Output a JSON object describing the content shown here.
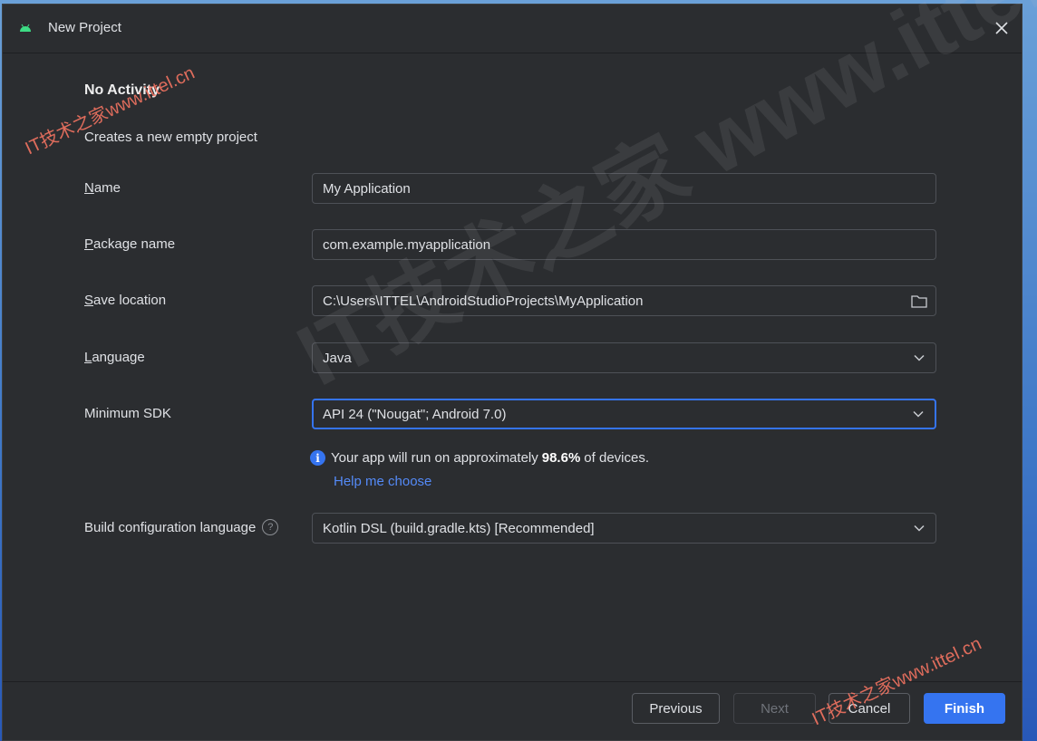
{
  "window": {
    "title": "New Project",
    "close_icon": "close-icon",
    "app_icon": "android-icon"
  },
  "page": {
    "heading": "No Activity",
    "subheading": "Creates a new empty project"
  },
  "form": {
    "name": {
      "label_mnemonic": "N",
      "label_rest": "ame",
      "value": "My Application"
    },
    "package": {
      "label_mnemonic": "P",
      "label_rest": "ackage name",
      "value": "com.example.myapplication"
    },
    "save_location": {
      "label_mnemonic": "S",
      "label_rest": "ave location",
      "value": "C:\\Users\\ITTEL\\AndroidStudioProjects\\MyApplication",
      "icon": "folder-icon"
    },
    "language": {
      "label_mnemonic": "L",
      "label_rest": "anguage",
      "value": "Java",
      "icon": "chevron-down-icon"
    },
    "min_sdk": {
      "label": "Minimum SDK",
      "value": "API 24 (\"Nougat\"; Android 7.0)",
      "icon": "chevron-down-icon"
    },
    "info": {
      "prefix": "Your app will run on approximately",
      "percent": "98.6%",
      "suffix": "of devices.",
      "link": "Help me choose",
      "icon": "info-icon"
    },
    "build_config": {
      "label": "Build configuration language",
      "value": "Kotlin DSL (build.gradle.kts) [Recommended]",
      "help_glyph": "?",
      "icon": "chevron-down-icon"
    }
  },
  "footer": {
    "previous": "Previous",
    "next": "Next",
    "cancel": "Cancel",
    "finish": "Finish"
  },
  "watermarks": {
    "top_left": "IT技术之家www.ittel.cn",
    "center": "IT技术之家 www.ittel.cn",
    "bottom_right": "IT技术之家www.ittel.cn"
  },
  "colors": {
    "accent": "#3574f0",
    "link": "#548af7",
    "background": "#2b2d30"
  }
}
